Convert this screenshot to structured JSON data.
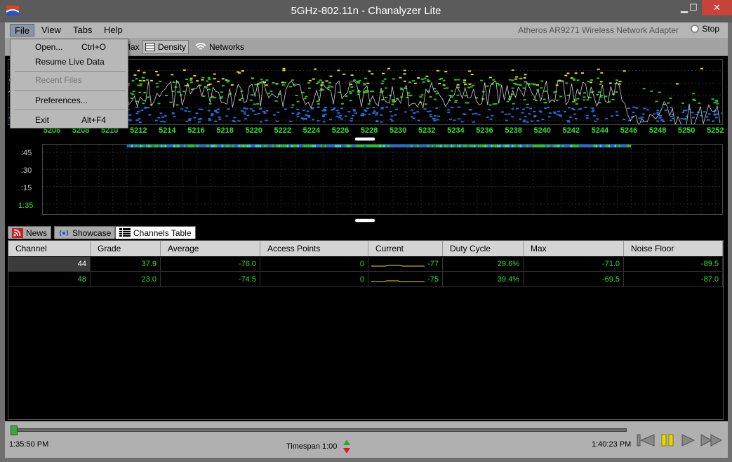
{
  "window": {
    "title": "5GHz-802.11n - Chanalyzer Lite",
    "minimize": "▁",
    "maximize": "☐",
    "close": "✕"
  },
  "menu": {
    "file": "File",
    "view": "View",
    "tabs": "Tabs",
    "help": "Help",
    "adapter": "Atheros AR9271 Wireless Network Adapter",
    "stop": "Stop"
  },
  "file_menu": {
    "open": "Open...",
    "open_shortcut": "Ctrl+O",
    "resume": "Resume Live Data",
    "recent": "Recent Files",
    "preferences": "Preferences...",
    "exit": "Exit",
    "exit_shortcut": "Alt+F4"
  },
  "toolbar": {
    "max": "Max",
    "density": "Density",
    "networks": "Networks"
  },
  "spectrum": {
    "freq_ticks": [
      "5206",
      "5208",
      "5210",
      "5212",
      "5214",
      "5216",
      "5218",
      "5220",
      "5222",
      "5224",
      "5226",
      "5228",
      "5230",
      "5232",
      "5234",
      "5236",
      "5238",
      "5240",
      "5242",
      "5244",
      "5246",
      "5248",
      "5250",
      "5252"
    ],
    "colors": {
      "axis": "#2fe22f",
      "trace": "#cfcfcf",
      "high": "#e8e000",
      "mid": "#27c427",
      "low": "#1f6fe0"
    }
  },
  "density": {
    "time_ticks": [
      ":45",
      ":30",
      ":15",
      "1:35"
    ]
  },
  "tabs": {
    "news": "News",
    "showcase": "Showcase",
    "channels": "Channels Table"
  },
  "table": {
    "headers": [
      "Channel",
      "Grade",
      "Average",
      "Access Points",
      "Current",
      "Duty Cycle",
      "Max",
      "Noise Floor"
    ],
    "rows": [
      {
        "channel": "44",
        "grade": "37.9",
        "average": "-76.0",
        "access_points": "0",
        "current": "-77",
        "duty_cycle": "29.6%",
        "max": "-71.0",
        "noise_floor": "-89.5"
      },
      {
        "channel": "48",
        "grade": "23.0",
        "average": "-74.5",
        "access_points": "0",
        "current": "-75",
        "duty_cycle": "39.4%",
        "max": "-69.5",
        "noise_floor": "-87.0"
      }
    ]
  },
  "playback": {
    "start_time": "1:35:50 PM",
    "end_time": "1:40:23 PM",
    "timespan": "Timespan 1:00"
  }
}
